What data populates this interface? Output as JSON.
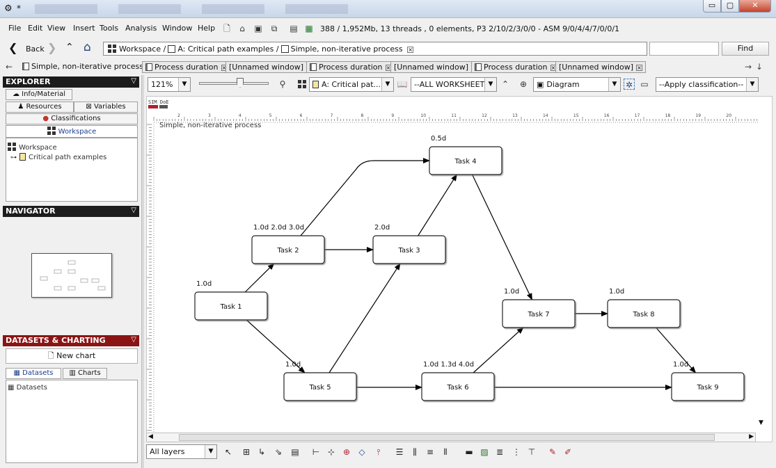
{
  "window": {
    "title": "*",
    "min_label": "▭",
    "max_label": "▢",
    "close_label": "✕"
  },
  "menu": {
    "items": [
      "File",
      "Edit",
      "View",
      "Insert",
      "Tools",
      "Analysis",
      "Window",
      "Help"
    ]
  },
  "status": "388 / 1,952Mb, 13 threads , 0 elements, P3 2/10/2/3/0/0 - ASM 9/0/4/4/7/0/0/1",
  "nav": {
    "back_label": "Back",
    "breadcrumb": [
      "Workspace",
      "A: Critical path examples",
      "Simple, non-iterative process"
    ],
    "find_label": "Find"
  },
  "doc_tabs": [
    "Simple, non-iterative process",
    "Process duration",
    "[Unnamed window]",
    "Process duration",
    "[Unnamed window]",
    "Process duration",
    "[Unnamed window]"
  ],
  "explorer": {
    "title": "EXPLORER",
    "tabs": [
      "Info/Material",
      "Resources",
      "Variables",
      "Classifications",
      "Workspace"
    ],
    "tree": [
      "Workspace",
      "Critical path examples"
    ]
  },
  "navigator": {
    "title": "NAVIGATOR"
  },
  "datasets": {
    "title": "DATASETS & CHARTING",
    "new_chart": "New chart",
    "tabs": [
      "Datasets",
      "Charts"
    ],
    "list_item": "Datasets"
  },
  "canvas_toolbar": {
    "zoom": "121%",
    "model": "A: Critical pat...",
    "worksheet": "--ALL WORKSHEET...",
    "view": "Diagram",
    "classification": "--Apply classification--"
  },
  "canvas": {
    "title": "Simple, non-iterative process",
    "ruler_labels": [
      "2",
      "3",
      "4",
      "5",
      "6",
      "7",
      "8",
      "9",
      "10",
      "11",
      "12",
      "13",
      "14",
      "15",
      "16",
      "17",
      "18",
      "19",
      "20"
    ],
    "tasks": [
      {
        "id": "t1",
        "label": "Task 1",
        "duration": "1.0d"
      },
      {
        "id": "t2",
        "label": "Task 2",
        "duration": "1.0d 2.0d 3.0d"
      },
      {
        "id": "t3",
        "label": "Task 3",
        "duration": "2.0d"
      },
      {
        "id": "t4",
        "label": "Task 4",
        "duration": "0.5d"
      },
      {
        "id": "t5",
        "label": "Task 5",
        "duration": "1.0d"
      },
      {
        "id": "t6",
        "label": "Task 6",
        "duration": "1.0d 1.3d 4.0d"
      },
      {
        "id": "t7",
        "label": "Task 7",
        "duration": "1.0d"
      },
      {
        "id": "t8",
        "label": "Task 8",
        "duration": "1.0d"
      },
      {
        "id": "t9",
        "label": "Task 9",
        "duration": "1.0d"
      }
    ],
    "links": [
      [
        "t1",
        "t2"
      ],
      [
        "t1",
        "t5"
      ],
      [
        "t2",
        "t3"
      ],
      [
        "t2",
        "t4"
      ],
      [
        "t3",
        "t4"
      ],
      [
        "t5",
        "t3"
      ],
      [
        "t5",
        "t6"
      ],
      [
        "t4",
        "t7"
      ],
      [
        "t6",
        "t7"
      ],
      [
        "t6",
        "t9"
      ],
      [
        "t7",
        "t8"
      ],
      [
        "t8",
        "t9"
      ]
    ]
  },
  "bottom": {
    "layers": "All layers"
  }
}
